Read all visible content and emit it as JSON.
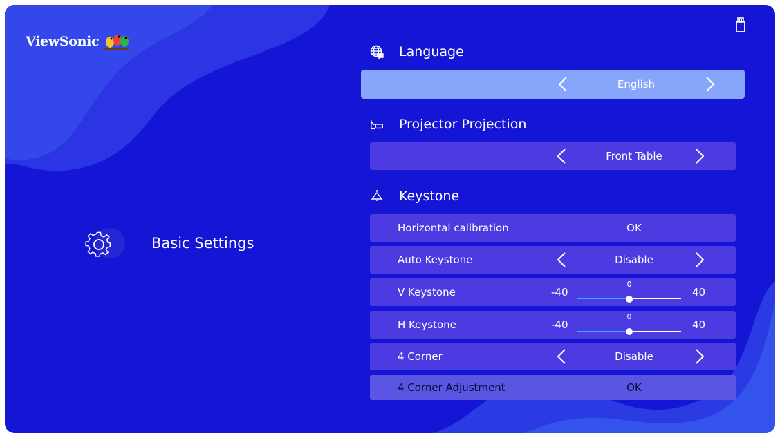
{
  "brand": {
    "name": "ViewSonic"
  },
  "sidebar": {
    "label": "Basic Settings"
  },
  "language": {
    "title": "Language",
    "value": "English"
  },
  "projection": {
    "title": "Projector Projection",
    "value": "Front Table"
  },
  "keystone": {
    "title": "Keystone",
    "rows": {
      "horizontal": {
        "label": "Horizontal calibration",
        "value": "OK"
      },
      "auto": {
        "label": "Auto Keystone",
        "value": "Disable"
      },
      "v": {
        "label": "V Keystone",
        "min": "-40",
        "max": "40",
        "value": "0",
        "level": 0.5
      },
      "h": {
        "label": "H Keystone",
        "min": "-40",
        "max": "40",
        "value": "0",
        "level": 0.5
      },
      "corner": {
        "label": "4 Corner",
        "value": "Disable"
      },
      "corner_adj": {
        "label": "4 Corner Adjustment",
        "value": "OK"
      }
    }
  },
  "colors": {
    "background": "#1515d6",
    "row": "#4b3be0",
    "focused_row": "#88a5fc",
    "slider_fill": "#3fa8ff"
  },
  "icons": [
    "usb-icon",
    "globe-icon",
    "projector-icon",
    "keystone-icon",
    "gear-icon",
    "chevron-left-icon",
    "chevron-right-icon"
  ]
}
